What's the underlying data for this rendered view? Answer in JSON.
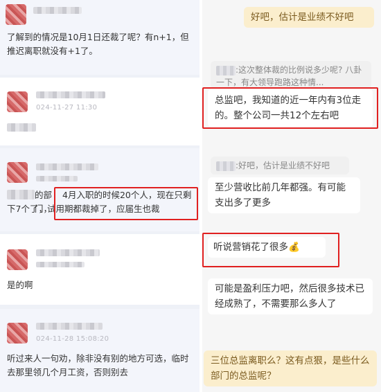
{
  "left": {
    "comment1": {
      "text": "了解到的情况是10月1日还裁了呢？有n+1，但推迟离职就没有+1了。"
    },
    "comment2": {
      "timestamp": "024-11-27 11:30",
      "text": ""
    },
    "comment3": {
      "dept_suffix": "的部门，",
      "highlight": "4月入职的时候20个人，现在只剩下7个了，试用期都裁掉了，应届生也裁"
    },
    "comment4": {
      "text": "是的啊"
    },
    "comment5": {
      "timestamp": "024-11-28 15:08:20",
      "text": "听过来人一句劝，除非没有别的地方可选，临时去那里领几个月工资，否则别去"
    }
  },
  "right": {
    "msg1": "好吧，估计是业绩不好吧",
    "quote1": ":这次整体裁的比例说多少呢? 八卦一下，有大领导跑路这种情...",
    "msg2": "总监吧，我知道的近一年内有3位走的。整个公司一共12个左右吧",
    "quote2": ":好吧，估计是业绩不好吧",
    "msg3": "至少营收比前几年都强。有可能支出多了更多",
    "msg4": "听说营销花了很多",
    "msg4_emoji": "💰",
    "msg5": "可能是盈利压力吧，然后很多技术已经成熟了，不需要那么多人了",
    "msg6": "三位总监离职么？这有点狠，是些什么部门的总监呢？"
  },
  "colors": {
    "highlight_border": "#e02020",
    "yellow_bubble": "#fbeecd"
  }
}
